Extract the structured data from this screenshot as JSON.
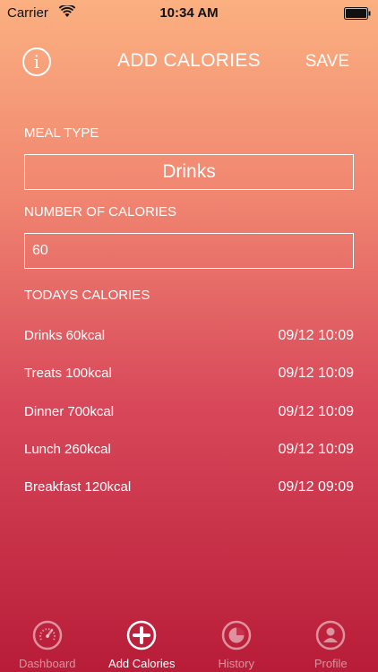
{
  "status_bar": {
    "carrier": "Carrier",
    "time": "10:34 AM"
  },
  "nav": {
    "title": "ADD CALORIES",
    "save_label": "SAVE",
    "info_label": "i"
  },
  "form": {
    "meal_type_label": "MEAL TYPE",
    "meal_type_value": "Drinks",
    "calories_label": "NUMBER OF CALORIES",
    "calories_value": "60"
  },
  "todays": {
    "label": "TODAYS CALORIES",
    "entries": [
      {
        "name": "Drinks 60kcal",
        "time": "09/12 10:09"
      },
      {
        "name": "Treats 100kcal",
        "time": "09/12 10:09"
      },
      {
        "name": "Dinner 700kcal",
        "time": "09/12 10:09"
      },
      {
        "name": "Lunch 260kcal",
        "time": "09/12 10:09"
      },
      {
        "name": "Breakfast 120kcal",
        "time": "09/12 09:09"
      }
    ]
  },
  "tabs": [
    {
      "label": "Dashboard",
      "icon": "gauge-icon",
      "active": false
    },
    {
      "label": "Add Calories",
      "icon": "plus-circle-icon",
      "active": true
    },
    {
      "label": "History",
      "icon": "pie-chart-icon",
      "active": false
    },
    {
      "label": "Profile",
      "icon": "user-icon",
      "active": false
    }
  ],
  "colors": {
    "gradient_top": "#fbb080",
    "gradient_bottom": "#b81c38",
    "text": "#ffffff"
  }
}
